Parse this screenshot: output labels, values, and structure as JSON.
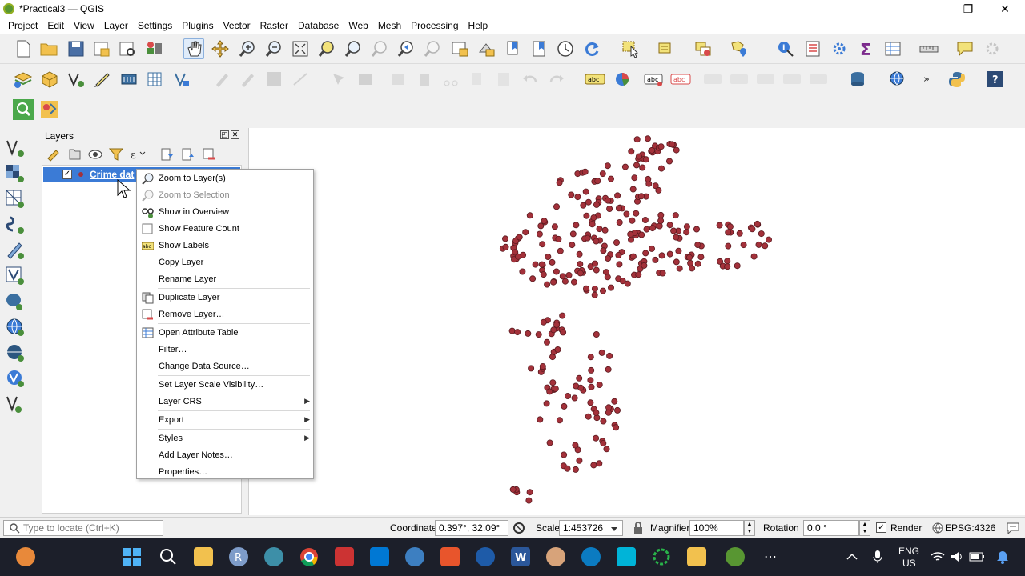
{
  "window": {
    "title": "*Practical3 — QGIS",
    "minimize": "—",
    "maximize": "❐",
    "close": "✕"
  },
  "menubar": [
    "Project",
    "Edit",
    "View",
    "Layer",
    "Settings",
    "Plugins",
    "Vector",
    "Raster",
    "Database",
    "Web",
    "Mesh",
    "Processing",
    "Help"
  ],
  "layers_panel": {
    "title": "Layers",
    "layer": {
      "name": "Crime dat",
      "checked": "✓"
    }
  },
  "context_menu": {
    "items": [
      {
        "label": "Zoom to Layer(s)",
        "icon": "zoom-layer-icon",
        "enabled": true
      },
      {
        "label": "Zoom to Selection",
        "icon": "zoom-selection-icon",
        "enabled": false
      },
      {
        "label": "Show in Overview",
        "icon": "overview-icon",
        "enabled": true
      },
      {
        "label": "Show Feature Count",
        "icon": "checkbox-icon",
        "enabled": true
      },
      {
        "label": "Show Labels",
        "icon": "labels-icon",
        "enabled": true
      },
      {
        "label": "Copy Layer",
        "icon": "",
        "enabled": true
      },
      {
        "label": "Rename Layer",
        "icon": "",
        "enabled": true
      },
      {
        "label": "Duplicate Layer",
        "icon": "duplicate-icon",
        "enabled": true
      },
      {
        "label": "Remove Layer…",
        "icon": "remove-layer-icon",
        "enabled": true
      },
      {
        "label": "Open Attribute Table",
        "icon": "attribute-table-icon",
        "enabled": true
      },
      {
        "label": "Filter…",
        "icon": "",
        "enabled": true
      },
      {
        "label": "Change Data Source…",
        "icon": "",
        "enabled": true
      },
      {
        "label": "Set Layer Scale Visibility…",
        "icon": "",
        "enabled": true
      },
      {
        "label": "Layer CRS",
        "icon": "",
        "enabled": true,
        "submenu": true
      },
      {
        "label": "Export",
        "icon": "",
        "enabled": true,
        "submenu": true
      },
      {
        "label": "Styles",
        "icon": "",
        "enabled": true,
        "submenu": true
      },
      {
        "label": "Add Layer Notes…",
        "icon": "",
        "enabled": true
      },
      {
        "label": "Properties…",
        "icon": "",
        "enabled": true
      }
    ],
    "submenu_arrow": "▶"
  },
  "map": {
    "point_color": "#a3313a",
    "point_outline": "#5a1a1f"
  },
  "statusbar": {
    "locator_placeholder": "Type to locate (Ctrl+K)",
    "coordinate_label": "Coordinate",
    "coordinate_value": "0.397°, 32.09°",
    "scale_label": "Scale",
    "scale_value": "1:453726",
    "magnifier_label": "Magnifier",
    "magnifier_value": "100%",
    "rotation_label": "Rotation",
    "rotation_value": "0.0 °",
    "render_label": "Render",
    "crs": "EPSG:4326"
  },
  "taskbar": {
    "lang_top": "ENG",
    "lang_bottom": "US",
    "more": "⋯"
  },
  "colors": {
    "accent": "#3b7bd6",
    "taskbar": "#1c1f2a"
  }
}
